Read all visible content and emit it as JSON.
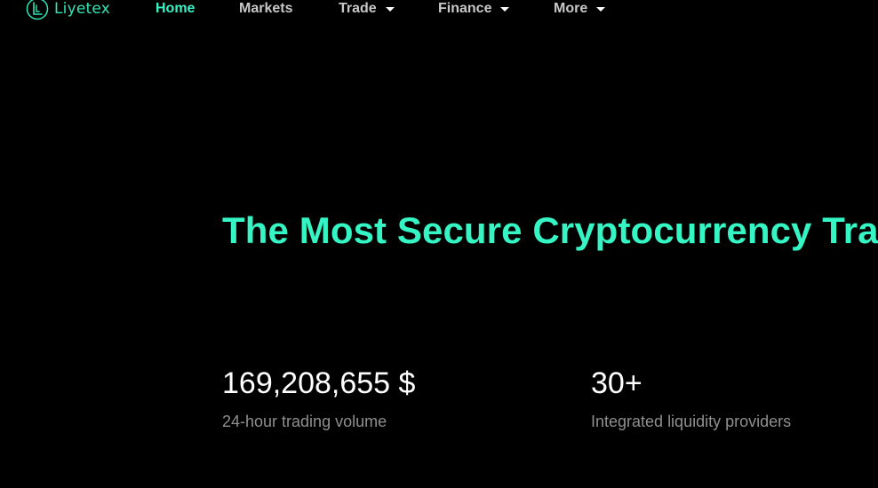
{
  "brand": {
    "name": "Liyetex",
    "icon": "liyetex-logo-icon",
    "color": "#2ee6b6"
  },
  "nav": {
    "items": [
      {
        "label": "Home",
        "active": true,
        "dropdown": false
      },
      {
        "label": "Markets",
        "active": false,
        "dropdown": false
      },
      {
        "label": "Trade",
        "active": false,
        "dropdown": true
      },
      {
        "label": "Finance",
        "active": false,
        "dropdown": true
      },
      {
        "label": "More",
        "active": false,
        "dropdown": true
      }
    ],
    "dropdown_icon": "caret-down-icon"
  },
  "hero": {
    "title": "The Most Secure Cryptocurrency Trading Platform"
  },
  "stats": [
    {
      "value": "169,208,655 $",
      "label": "24-hour trading volume"
    },
    {
      "value": "30+",
      "label": "Integrated liquidity providers"
    }
  ],
  "colors": {
    "background": "#000000",
    "accent": "#35f5c4",
    "nav_text": "#c8c8c8",
    "stat_value": "#ffffff",
    "stat_label": "#8f8f8f"
  }
}
